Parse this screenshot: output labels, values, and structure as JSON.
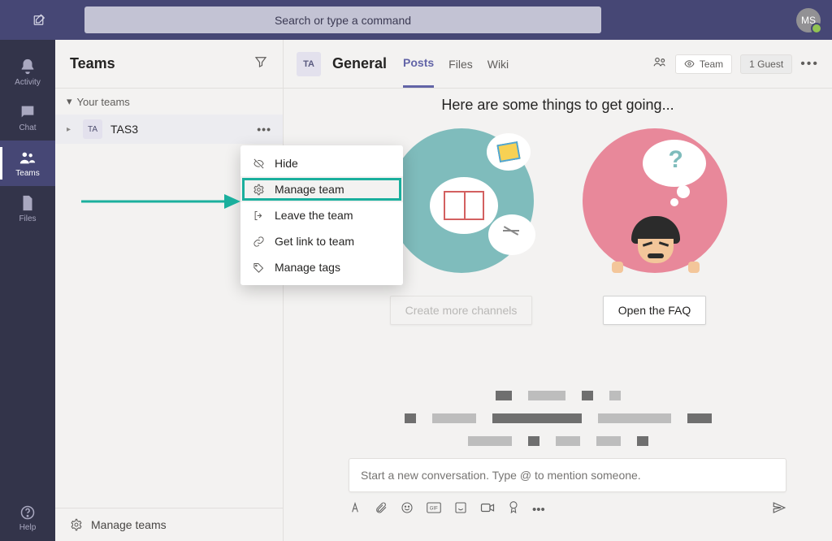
{
  "topbar": {
    "search_placeholder": "Search or type a command",
    "profile_initials": "MS"
  },
  "rail": {
    "items": [
      {
        "label": "Activity"
      },
      {
        "label": "Chat"
      },
      {
        "label": "Teams"
      },
      {
        "label": "Files"
      }
    ],
    "help_label": "Help"
  },
  "teams_panel": {
    "title": "Teams",
    "group_label": "Your teams",
    "team": {
      "avatar": "TA",
      "name": "TAS3"
    },
    "footer_label": "Manage teams"
  },
  "context_menu": {
    "items": [
      {
        "label": "Hide"
      },
      {
        "label": "Manage team"
      },
      {
        "label": "Leave the team"
      },
      {
        "label": "Get link to team"
      },
      {
        "label": "Manage tags"
      }
    ]
  },
  "channel": {
    "avatar": "TA",
    "name": "General",
    "tabs": [
      {
        "label": "Posts"
      },
      {
        "label": "Files"
      },
      {
        "label": "Wiki"
      }
    ],
    "privacy_label": "Team",
    "guest_label": "1 Guest",
    "intro": "Here are some things to get going...",
    "card1_button": "Create more channels",
    "card2_button": "Open the FAQ",
    "composer_placeholder": "Start a new conversation. Type @ to mention someone."
  }
}
